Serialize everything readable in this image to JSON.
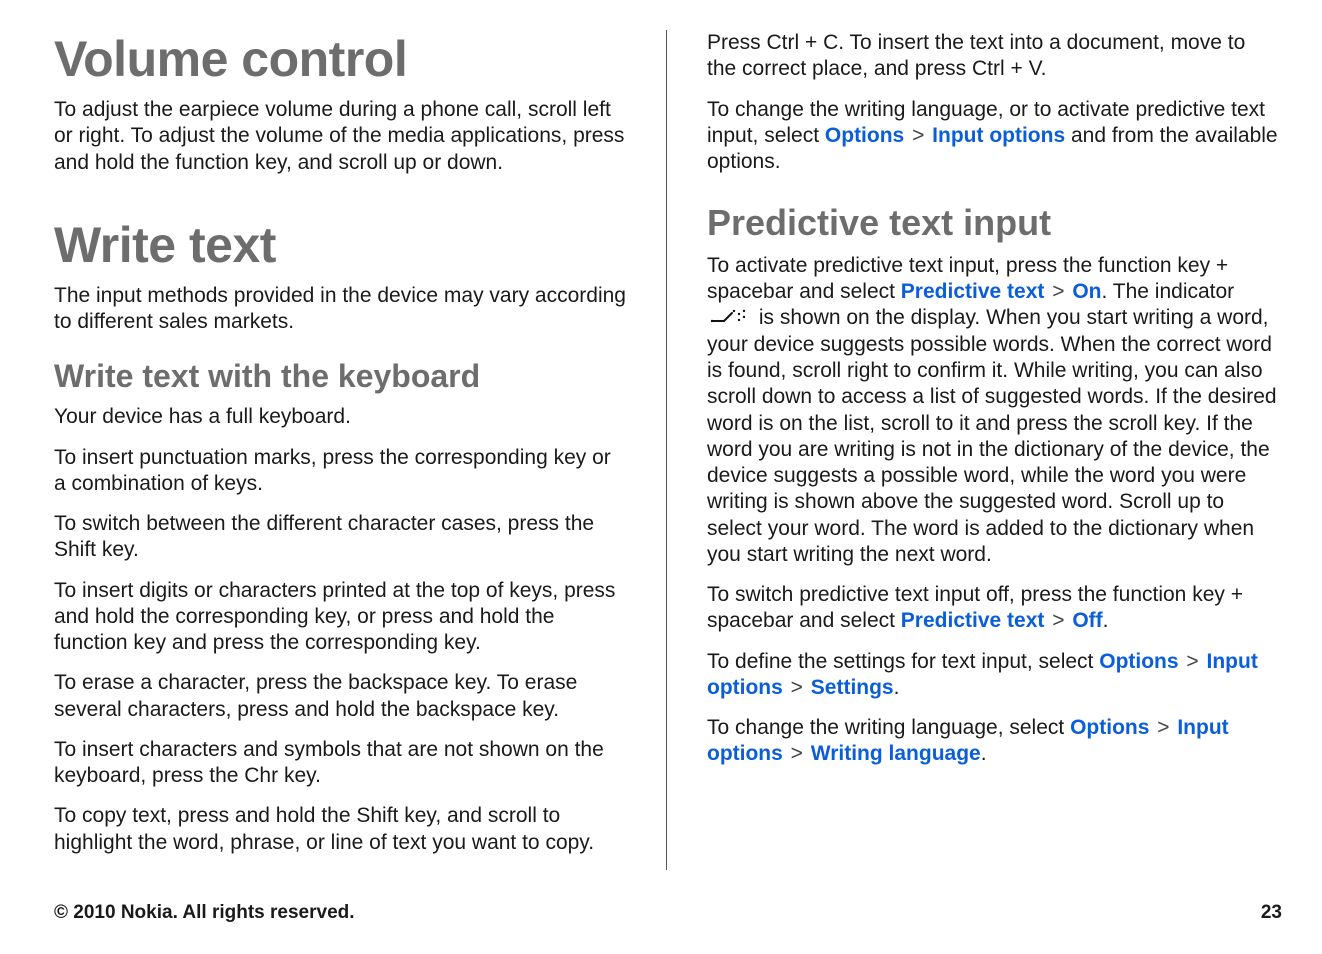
{
  "left": {
    "h1a": "Volume control",
    "p1": "To adjust the earpiece volume during a phone call, scroll left or right. To adjust the volume of the media applications, press and hold the function key, and scroll up or down.",
    "h1b": "Write text",
    "p2": "The input methods provided in the device may vary according to different sales markets.",
    "h3a": "Write text with the keyboard",
    "p3": "Your device has a full keyboard.",
    "p4": "To insert punctuation marks, press the corresponding key or a combination of keys.",
    "p5": "To switch between the different character cases, press the Shift key.",
    "p6": "To insert digits or characters printed at the top of keys, press and hold the corresponding key, or press and hold the function key and press the corresponding key.",
    "p7": "To erase a character, press the backspace key. To erase several characters, press and hold the backspace key.",
    "p8": "To insert characters and symbols that are not shown on the keyboard, press the Chr key.",
    "p9": "To copy text, press and hold the Shift key, and scroll to highlight the word, phrase, or line of text you want to copy."
  },
  "right": {
    "p1": "Press Ctrl + C. To insert the text into a document, move to the correct place, and press Ctrl + V.",
    "p2a": "To change the writing language, or to activate predictive text input, select ",
    "p2_opt1": "Options",
    "p2_gt1": " > ",
    "p2_opt2": "Input options",
    "p2b": " and from the available options.",
    "h2": "Predictive text input",
    "p3a": "To activate predictive text input, press the function key + spacebar and select ",
    "p3_opt1": "Predictive text",
    "p3_gt1": " > ",
    "p3_opt2": "On",
    "p3b": ". The indicator ",
    "p3c": " is shown on the display. When you start writing a word, your device suggests possible words. When the correct word is found, scroll right to confirm it. While writing, you can also scroll down to access a list of suggested words. If the desired word is on the list, scroll to it and press the scroll key. If the word you are writing is not in the dictionary of the device, the device suggests a possible word, while the word you were writing is shown above the suggested word. Scroll up to select your word. The word is added to the dictionary when you start writing the next word.",
    "p4a": "To switch predictive text input off, press the function key + spacebar and select ",
    "p4_opt1": "Predictive text",
    "p4_gt1": " > ",
    "p4_opt2": "Off",
    "p4b": ".",
    "p5a": "To define the settings for text input, select ",
    "p5_opt1": "Options",
    "p5_gt1": " > ",
    "p5_opt2": "Input options",
    "p5_gt2": " > ",
    "p5_opt3": "Settings",
    "p5b": ".",
    "p6a": "To change the writing language, select ",
    "p6_opt1": "Options",
    "p6_gt1": " > ",
    "p6_opt2": "Input options",
    "p6_gt2": " > ",
    "p6_opt3": "Writing language",
    "p6b": "."
  },
  "footer": {
    "left": "© 2010 Nokia. All rights reserved.",
    "right": "23"
  }
}
